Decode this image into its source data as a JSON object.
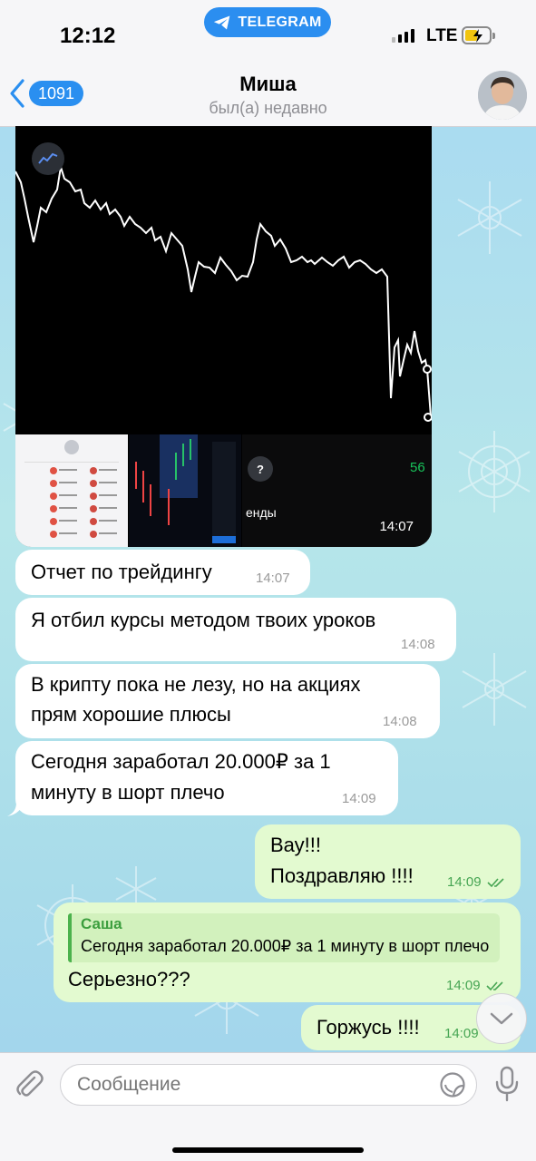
{
  "status_bar": {
    "time": "12:12",
    "app_pill": "TELEGRAM",
    "network": "LTE"
  },
  "header": {
    "back_count": "1091",
    "title": "Миша",
    "subtitle": "был(а) недавно"
  },
  "media": {
    "time": "14:07",
    "thumb3_number": "56",
    "thumb3_text": "енды"
  },
  "messages": [
    {
      "direction": "in",
      "text": "Отчет по трейдингу",
      "time": "14:07"
    },
    {
      "direction": "in",
      "text": "Я отбил курсы методом твоих уроков",
      "time": "14:08"
    },
    {
      "direction": "in",
      "line1": "В крипту пока не лезу, но на акциях",
      "line2": "прям хорошие плюсы",
      "time": "14:08"
    },
    {
      "direction": "in",
      "line1": "Сегодня заработал 20.000₽ за 1",
      "line2": "минуту в шорт плечо",
      "time": "14:09"
    },
    {
      "direction": "out",
      "line1": "Вау!!!",
      "line2": "Поздравляю !!!!",
      "time": "14:09"
    },
    {
      "direction": "out",
      "reply_name": "Саша",
      "reply_text": "Сегодня заработал 20.000₽ за 1 минуту в шорт плечо",
      "text": "Серьезно???",
      "time": "14:09"
    },
    {
      "direction": "out",
      "text": "Горжусь !!!!",
      "time": "14:09"
    }
  ],
  "input": {
    "placeholder": "Сообщение"
  },
  "colors": {
    "accent": "#2a8ff0",
    "outgoing_bubble": "#e3fad0",
    "incoming_bubble": "#ffffff",
    "check_green": "#46a553"
  }
}
